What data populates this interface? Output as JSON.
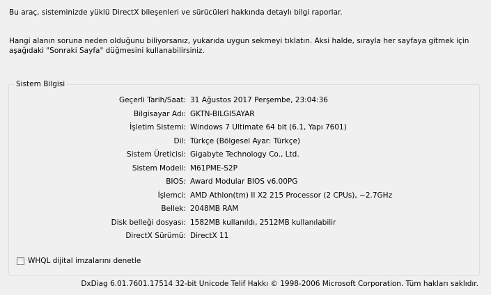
{
  "intro": {
    "line1": "Bu araç, sisteminizde yüklü DirectX bileşenleri ve sürücüleri hakkında detaylı bilgi raporlar.",
    "line2": "Hangi alanın soruna neden olduğunu biliyorsanız, yukarıda uygun sekmeyi tıklatın.  Aksi halde, sırayla her sayfaya gitmek için aşağıdaki \"Sonraki Sayfa\" düğmesini kullanabilirsiniz."
  },
  "system_info": {
    "title": "Sistem Bilgisi",
    "rows": [
      {
        "label": "Geçerli Tarih/Saat:",
        "value": "31 Ağustos 2017 Perşembe, 23:04:36"
      },
      {
        "label": "Bilgisayar Adı:",
        "value": "GKTN-BILGISAYAR"
      },
      {
        "label": "İşletim Sistemi:",
        "value": "Windows 7 Ultimate 64 bit (6.1, Yapı 7601)"
      },
      {
        "label": "Dil:",
        "value": "Türkçe (Bölgesel Ayar: Türkçe)"
      },
      {
        "label": "Sistem Üreticisi:",
        "value": "Gigabyte Technology Co., Ltd."
      },
      {
        "label": "Sistem Modeli:",
        "value": "M61PME-S2P"
      },
      {
        "label": "BIOS:",
        "value": "Award Modular BIOS v6.00PG"
      },
      {
        "label": "İşlemci:",
        "value": "AMD Athlon(tm) II X2 215 Processor (2 CPUs), ~2.7GHz"
      },
      {
        "label": "Bellek:",
        "value": "2048MB RAM"
      },
      {
        "label": "Disk belleği dosyası:",
        "value": "1582MB kullanıldı, 2512MB kullanılabilir"
      },
      {
        "label": "DirectX Sürümü:",
        "value": "DirectX 11"
      }
    ]
  },
  "whql_checkbox": {
    "label": "WHQL dijital imzalarını denetle",
    "checked": false
  },
  "footer": {
    "text": "DxDiag 6.01.7601.17514 32-bit Unicode  Telif Hakkı © 1998-2006 Microsoft Corporation.  Tüm hakları saklıdır."
  },
  "colors": {
    "background": "#f0f0f0",
    "groupbox_border": "#d5dfe5"
  }
}
